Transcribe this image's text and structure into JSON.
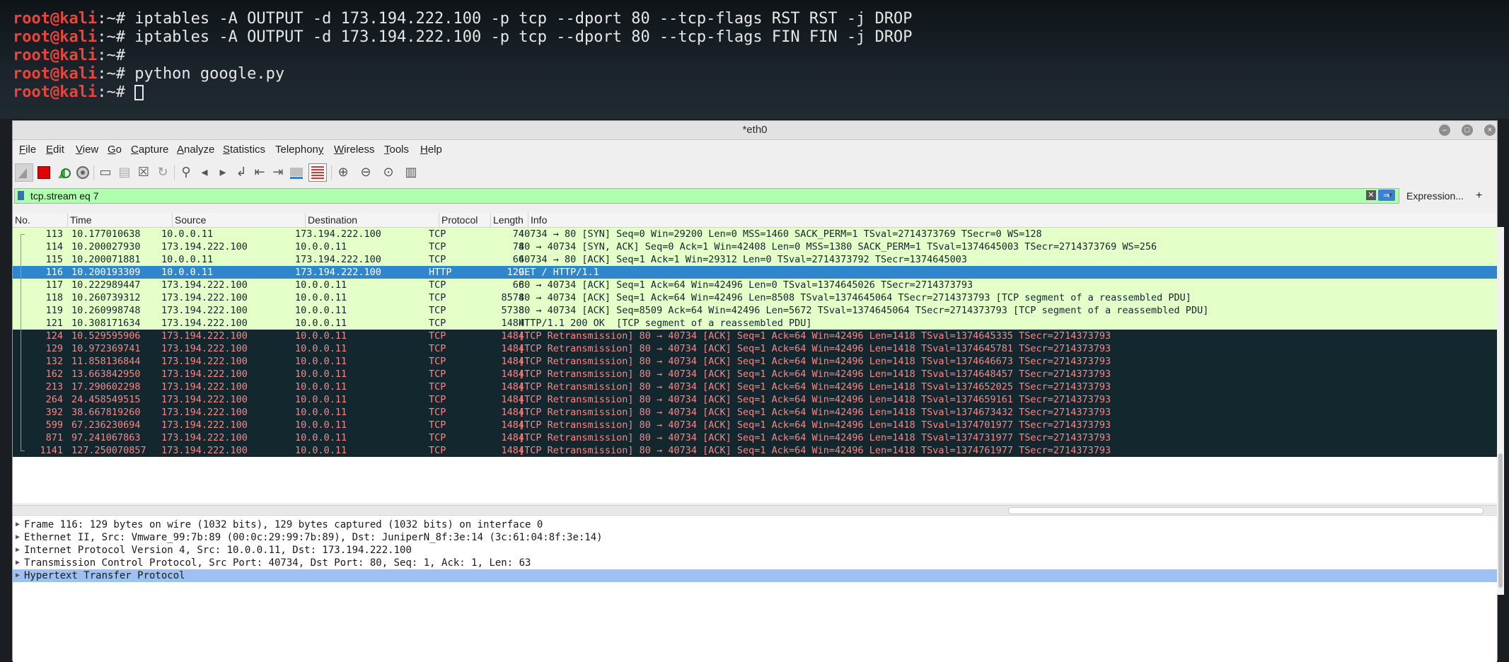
{
  "terminal": {
    "lines": [
      {
        "prompt": "root@kali",
        "sep": ":~# ",
        "cmd": "iptables -A OUTPUT -d 173.194.222.100 -p tcp --dport 80 --tcp-flags RST RST -j DROP"
      },
      {
        "prompt": "root@kali",
        "sep": ":~# ",
        "cmd": "iptables -A OUTPUT -d 173.194.222.100 -p tcp --dport 80 --tcp-flags FIN FIN -j DROP"
      },
      {
        "prompt": "root@kali",
        "sep": ":~# ",
        "cmd": ""
      },
      {
        "prompt": "root@kali",
        "sep": ":~# ",
        "cmd": "python google.py"
      },
      {
        "prompt": "root@kali",
        "sep": ":~# ",
        "cmd": ""
      }
    ]
  },
  "window": {
    "title": "*eth0",
    "controls": {
      "minimize": "–",
      "maximize": "□",
      "close": "×"
    }
  },
  "menubar": {
    "items": [
      {
        "pre": "",
        "u": "F",
        "post": "ile"
      },
      {
        "pre": "",
        "u": "E",
        "post": "dit"
      },
      {
        "pre": "",
        "u": "V",
        "post": "iew"
      },
      {
        "pre": "",
        "u": "G",
        "post": "o"
      },
      {
        "pre": "",
        "u": "C",
        "post": "apture"
      },
      {
        "pre": "",
        "u": "A",
        "post": "nalyze"
      },
      {
        "pre": "",
        "u": "S",
        "post": "tatistics"
      },
      {
        "pre": "Telephon",
        "u": "y",
        "post": ""
      },
      {
        "pre": "",
        "u": "W",
        "post": "ireless"
      },
      {
        "pre": "",
        "u": "T",
        "post": "ools"
      },
      {
        "pre": "",
        "u": "H",
        "post": "elp"
      }
    ]
  },
  "toolbar": {
    "icons": [
      "shark-fin-icon",
      "stop-icon",
      "restart-icon",
      "options-icon",
      "open-icon",
      "save-icon",
      "close-file-icon",
      "reload-icon",
      "find-icon",
      "back-icon",
      "forward-icon",
      "goto-icon",
      "first-icon",
      "last-icon",
      "autoscroll-icon",
      "colorize-icon",
      "zoom-in-icon",
      "zoom-out-icon",
      "zoom-normal-icon",
      "resize-columns-icon"
    ]
  },
  "filter": {
    "value": "tcp.stream eq 7",
    "expression_label": "Expression...",
    "plus": "+"
  },
  "columns": [
    "No.",
    "Time",
    "Source",
    "Destination",
    "Protocol",
    "Length",
    "Info"
  ],
  "packets": [
    {
      "no": "113",
      "time": "10.177010638",
      "src": "10.0.0.11",
      "dst": "173.194.222.100",
      "proto": "TCP",
      "len": "74",
      "info": "40734 → 80 [SYN] Seq=0 Win=29200 Len=0 MSS=1460 SACK_PERM=1 TSval=2714373769 TSecr=0 WS=128",
      "style": "green"
    },
    {
      "no": "114",
      "time": "10.200027930",
      "src": "173.194.222.100",
      "dst": "10.0.0.11",
      "proto": "TCP",
      "len": "74",
      "info": "80 → 40734 [SYN, ACK] Seq=0 Ack=1 Win=42408 Len=0 MSS=1380 SACK_PERM=1 TSval=1374645003 TSecr=2714373769 WS=256",
      "style": "green"
    },
    {
      "no": "115",
      "time": "10.200071881",
      "src": "10.0.0.11",
      "dst": "173.194.222.100",
      "proto": "TCP",
      "len": "66",
      "info": "40734 → 80 [ACK] Seq=1 Ack=1 Win=29312 Len=0 TSval=2714373792 TSecr=1374645003",
      "style": "green"
    },
    {
      "no": "116",
      "time": "10.200193309",
      "src": "10.0.0.11",
      "dst": "173.194.222.100",
      "proto": "HTTP",
      "len": "129",
      "info": "GET / HTTP/1.1",
      "style": "sel"
    },
    {
      "no": "117",
      "time": "10.222989447",
      "src": "173.194.222.100",
      "dst": "10.0.0.11",
      "proto": "TCP",
      "len": "66",
      "info": "80 → 40734 [ACK] Seq=1 Ack=64 Win=42496 Len=0 TSval=1374645026 TSecr=2714373793",
      "style": "green"
    },
    {
      "no": "118",
      "time": "10.260739312",
      "src": "173.194.222.100",
      "dst": "10.0.0.11",
      "proto": "TCP",
      "len": "8574",
      "info": "80 → 40734 [ACK] Seq=1 Ack=64 Win=42496 Len=8508 TSval=1374645064 TSecr=2714373793 [TCP segment of a reassembled PDU]",
      "style": "green"
    },
    {
      "no": "119",
      "time": "10.260998748",
      "src": "173.194.222.100",
      "dst": "10.0.0.11",
      "proto": "TCP",
      "len": "5738",
      "info": "80 → 40734 [ACK] Seq=8509 Ack=64 Win=42496 Len=5672 TSval=1374645064 TSecr=2714373793 [TCP segment of a reassembled PDU]",
      "style": "green"
    },
    {
      "no": "121",
      "time": "10.308171634",
      "src": "173.194.222.100",
      "dst": "10.0.0.11",
      "proto": "TCP",
      "len": "1484",
      "info": "HTTP/1.1 200 OK  [TCP segment of a reassembled PDU]",
      "style": "green"
    },
    {
      "no": "124",
      "time": "10.529595906",
      "src": "173.194.222.100",
      "dst": "10.0.0.11",
      "proto": "TCP",
      "len": "1484",
      "info": "[TCP Retransmission] 80 → 40734 [ACK] Seq=1 Ack=64 Win=42496 Len=1418 TSval=1374645335 TSecr=2714373793",
      "style": "retx"
    },
    {
      "no": "129",
      "time": "10.972369741",
      "src": "173.194.222.100",
      "dst": "10.0.0.11",
      "proto": "TCP",
      "len": "1484",
      "info": "[TCP Retransmission] 80 → 40734 [ACK] Seq=1 Ack=64 Win=42496 Len=1418 TSval=1374645781 TSecr=2714373793",
      "style": "retx"
    },
    {
      "no": "132",
      "time": "11.858136844",
      "src": "173.194.222.100",
      "dst": "10.0.0.11",
      "proto": "TCP",
      "len": "1484",
      "info": "[TCP Retransmission] 80 → 40734 [ACK] Seq=1 Ack=64 Win=42496 Len=1418 TSval=1374646673 TSecr=2714373793",
      "style": "retx"
    },
    {
      "no": "162",
      "time": "13.663842950",
      "src": "173.194.222.100",
      "dst": "10.0.0.11",
      "proto": "TCP",
      "len": "1484",
      "info": "[TCP Retransmission] 80 → 40734 [ACK] Seq=1 Ack=64 Win=42496 Len=1418 TSval=1374648457 TSecr=2714373793",
      "style": "retx"
    },
    {
      "no": "213",
      "time": "17.290602298",
      "src": "173.194.222.100",
      "dst": "10.0.0.11",
      "proto": "TCP",
      "len": "1484",
      "info": "[TCP Retransmission] 80 → 40734 [ACK] Seq=1 Ack=64 Win=42496 Len=1418 TSval=1374652025 TSecr=2714373793",
      "style": "retx"
    },
    {
      "no": "264",
      "time": "24.458549515",
      "src": "173.194.222.100",
      "dst": "10.0.0.11",
      "proto": "TCP",
      "len": "1484",
      "info": "[TCP Retransmission] 80 → 40734 [ACK] Seq=1 Ack=64 Win=42496 Len=1418 TSval=1374659161 TSecr=2714373793",
      "style": "retx"
    },
    {
      "no": "392",
      "time": "38.667819260",
      "src": "173.194.222.100",
      "dst": "10.0.0.11",
      "proto": "TCP",
      "len": "1484",
      "info": "[TCP Retransmission] 80 → 40734 [ACK] Seq=1 Ack=64 Win=42496 Len=1418 TSval=1374673432 TSecr=2714373793",
      "style": "retx"
    },
    {
      "no": "599",
      "time": "67.236230694",
      "src": "173.194.222.100",
      "dst": "10.0.0.11",
      "proto": "TCP",
      "len": "1484",
      "info": "[TCP Retransmission] 80 → 40734 [ACK] Seq=1 Ack=64 Win=42496 Len=1418 TSval=1374701977 TSecr=2714373793",
      "style": "retx"
    },
    {
      "no": "871",
      "time": "97.241067863",
      "src": "173.194.222.100",
      "dst": "10.0.0.11",
      "proto": "TCP",
      "len": "1484",
      "info": "[TCP Retransmission] 80 → 40734 [ACK] Seq=1 Ack=64 Win=42496 Len=1418 TSval=1374731977 TSecr=2714373793",
      "style": "retx"
    },
    {
      "no": "1141",
      "time": "127.250070857",
      "src": "173.194.222.100",
      "dst": "10.0.0.11",
      "proto": "TCP",
      "len": "1484",
      "info": "[TCP Retransmission] 80 → 40734 [ACK] Seq=1 Ack=64 Win=42496 Len=1418 TSval=1374761977 TSecr=2714373793",
      "style": "retx"
    }
  ],
  "details": [
    {
      "text": "Frame 116: 129 bytes on wire (1032 bits), 129 bytes captured (1032 bits) on interface 0",
      "selected": false
    },
    {
      "text": "Ethernet II, Src: Vmware_99:7b:89 (00:0c:29:99:7b:89), Dst: JuniperN_8f:3e:14 (3c:61:04:8f:3e:14)",
      "selected": false
    },
    {
      "text": "Internet Protocol Version 4, Src: 10.0.0.11, Dst: 173.194.222.100",
      "selected": false
    },
    {
      "text": "Transmission Control Protocol, Src Port: 40734, Dst Port: 80, Seq: 1, Ack: 1, Len: 63",
      "selected": false
    },
    {
      "text": "Hypertext Transfer Protocol",
      "selected": true
    }
  ],
  "colors": {
    "green_row": "#e4ffc7",
    "selected_row": "#2f86cd",
    "retransmission_row_bg": "#12272e",
    "retransmission_row_fg": "#f78787",
    "filter_ok": "#afffaf",
    "prompt": "#e8453c"
  }
}
